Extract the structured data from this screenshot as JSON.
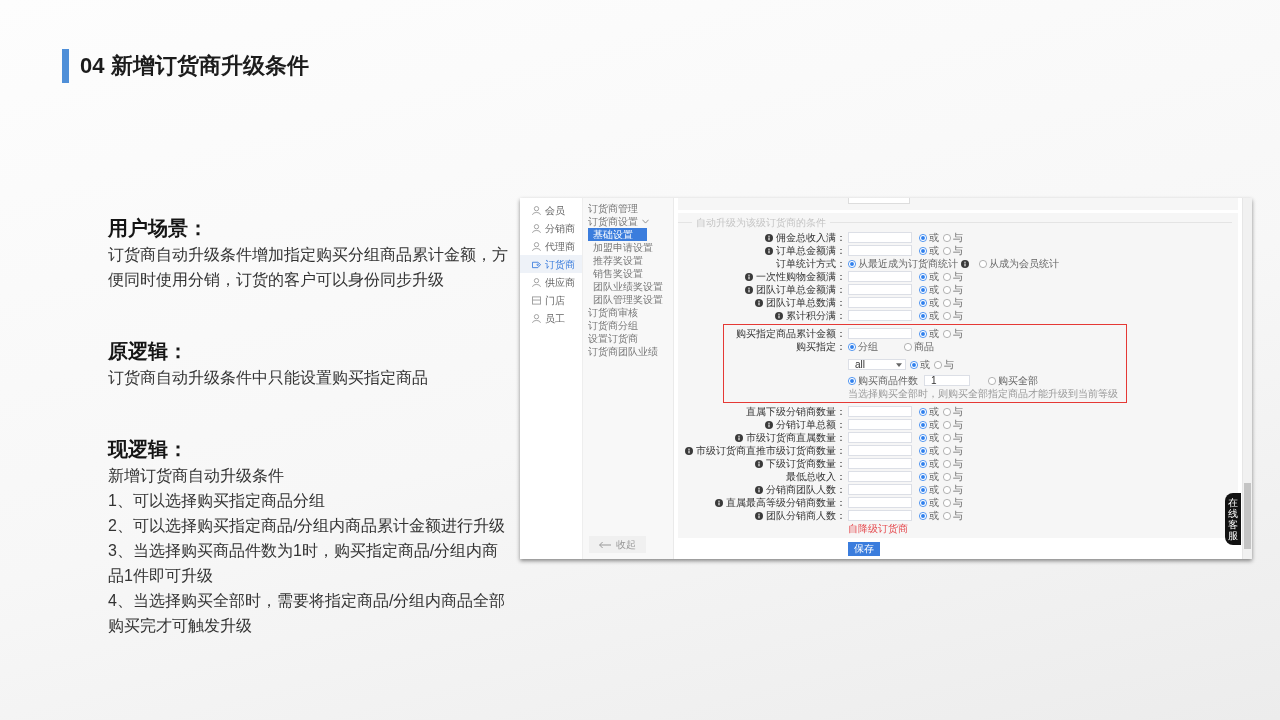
{
  "slide": {
    "title": "04 新增订货商升级条件"
  },
  "sections": [
    {
      "heading": "用户场景：",
      "lines": [
        "订货商自动升级条件增加指定购买分组商品累计金额，方便同时使用分销，订货的客户可以身份同步升级"
      ]
    },
    {
      "heading": "原逻辑：",
      "lines": [
        "订货商自动升级条件中只能设置购买指定商品"
      ]
    },
    {
      "heading": "现逻辑：",
      "lines": [
        "新增订货商自动升级条件",
        "1、可以选择购买指定商品分组",
        "2、可以选择购买指定商品/分组内商品累计金额进行升级",
        "3、当选择购买商品件数为1时，购买指定商品/分组内商品1件即可升级",
        "4、当选择购买全部时，需要将指定商品/分组内商品全部购买完才可触发升级"
      ]
    }
  ],
  "screenshot": {
    "main_nav": [
      {
        "label": "会员",
        "selected": false
      },
      {
        "label": "分销商",
        "selected": false
      },
      {
        "label": "代理商",
        "selected": false
      },
      {
        "label": "订货商",
        "selected": true
      },
      {
        "label": "供应商",
        "selected": false
      },
      {
        "label": "门店",
        "selected": false
      },
      {
        "label": "员工",
        "selected": false
      }
    ],
    "sub_nav": [
      {
        "label": "订货商管理",
        "selected": false
      },
      {
        "label": "订货商设置",
        "selected": false,
        "expanded": true,
        "children": [
          {
            "label": "基础设置",
            "selected": true
          },
          {
            "label": "加盟申请设置",
            "selected": false
          },
          {
            "label": "推荐奖设置",
            "selected": false
          },
          {
            "label": "销售奖设置",
            "selected": false
          },
          {
            "label": "团队业绩奖设置",
            "selected": false
          },
          {
            "label": "团队管理奖设置",
            "selected": false
          }
        ]
      },
      {
        "label": "订货商审核",
        "selected": false
      },
      {
        "label": "订货商分组",
        "selected": false
      },
      {
        "label": "设置订货商",
        "selected": false
      },
      {
        "label": "订货商团队业绩",
        "selected": false
      }
    ],
    "collapse_label": "收起",
    "form": {
      "section_title": "自动升级为该级订货商的条件",
      "rows": [
        {
          "kind": "field",
          "label": "佣金总收入满：",
          "hint_icon": true,
          "options": [
            {
              "label": "或",
              "selected": true
            },
            {
              "label": "与",
              "selected": false
            }
          ]
        },
        {
          "kind": "field",
          "label": "订单总金额满：",
          "hint_icon": true,
          "options": [
            {
              "label": "或",
              "selected": true
            },
            {
              "label": "与",
              "selected": false
            }
          ]
        },
        {
          "kind": "stat",
          "label": "订单统计方式：",
          "options": [
            {
              "label": "从最近成为订货商统计",
              "selected": true,
              "hint_icon": true
            },
            {
              "label": "从成为会员统计",
              "selected": false,
              "hint_icon": false
            }
          ]
        },
        {
          "kind": "field",
          "label": "一次性购物金额满：",
          "hint_icon": true,
          "options": [
            {
              "label": "或",
              "selected": true
            },
            {
              "label": "与",
              "selected": false
            }
          ]
        },
        {
          "kind": "field",
          "label": "团队订单总金额满：",
          "hint_icon": true,
          "options": [
            {
              "label": "或",
              "selected": true
            },
            {
              "label": "与",
              "selected": false
            }
          ]
        },
        {
          "kind": "field",
          "label": "团队订单总数满：",
          "hint_icon": true,
          "options": [
            {
              "label": "或",
              "selected": true
            },
            {
              "label": "与",
              "selected": false
            }
          ]
        },
        {
          "kind": "field",
          "label": "累计积分满：",
          "hint_icon": true,
          "options": [
            {
              "label": "或",
              "selected": true
            },
            {
              "label": "与",
              "selected": false
            }
          ]
        },
        {
          "kind": "group",
          "rows": [
            {
              "kind": "field",
              "label": "购买指定商品累计金额：",
              "hint_icon": false,
              "options": [
                {
                  "label": "或",
                  "selected": true
                },
                {
                  "label": "与",
                  "selected": false
                }
              ]
            },
            {
              "kind": "choice",
              "label": "购买指定：",
              "options": [
                {
                  "label": "分组",
                  "selected": true
                },
                {
                  "label": "商品",
                  "selected": false
                }
              ]
            },
            {
              "kind": "select",
              "value": "all",
              "options": [
                {
                  "label": "或",
                  "selected": true
                },
                {
                  "label": "与",
                  "selected": false
                }
              ]
            },
            {
              "kind": "count",
              "value": "1",
              "options": [
                {
                  "label": "购买商品件数",
                  "selected": true
                },
                {
                  "label": "购买全部",
                  "selected": false
                }
              ]
            },
            {
              "kind": "note",
              "text": "当选择购买全部时，则购买全部指定商品才能升级到当前等级"
            }
          ]
        },
        {
          "kind": "field",
          "label": "直属下级分销商数量：",
          "hint_icon": false,
          "options": [
            {
              "label": "或",
              "selected": true
            },
            {
              "label": "与",
              "selected": false
            }
          ]
        },
        {
          "kind": "field",
          "label": "分销订单总额：",
          "hint_icon": true,
          "options": [
            {
              "label": "或",
              "selected": true
            },
            {
              "label": "与",
              "selected": false
            }
          ]
        },
        {
          "kind": "field",
          "label": "市级订货商直属数量：",
          "hint_icon": true,
          "options": [
            {
              "label": "或",
              "selected": true
            },
            {
              "label": "与",
              "selected": false
            }
          ]
        },
        {
          "kind": "field",
          "label": "市级订货商直推市级订货商数量：",
          "hint_icon": true,
          "options": [
            {
              "label": "或",
              "selected": true
            },
            {
              "label": "与",
              "selected": false
            }
          ]
        },
        {
          "kind": "field",
          "label": "下级订货商数量：",
          "hint_icon": true,
          "options": [
            {
              "label": "或",
              "selected": true
            },
            {
              "label": "与",
              "selected": false
            }
          ]
        },
        {
          "kind": "field",
          "label": "最低总收入：",
          "hint_icon": false,
          "options": [
            {
              "label": "或",
              "selected": true
            },
            {
              "label": "与",
              "selected": false
            }
          ]
        },
        {
          "kind": "field",
          "label": "分销商团队人数：",
          "hint_icon": true,
          "options": [
            {
              "label": "或",
              "selected": true
            },
            {
              "label": "与",
              "selected": false
            }
          ]
        },
        {
          "kind": "field",
          "label": "直属最高等级分销商数量：",
          "hint_icon": true,
          "options": [
            {
              "label": "或",
              "selected": true
            },
            {
              "label": "与",
              "selected": false
            }
          ]
        },
        {
          "kind": "field",
          "label": "团队分销商人数：",
          "hint_icon": true,
          "options": [
            {
              "label": "或",
              "selected": true
            },
            {
              "label": "与",
              "selected": false
            }
          ]
        },
        {
          "kind": "link",
          "text": "自降级订货商"
        }
      ],
      "save_label": "保存"
    },
    "float_button": "在线客服"
  }
}
